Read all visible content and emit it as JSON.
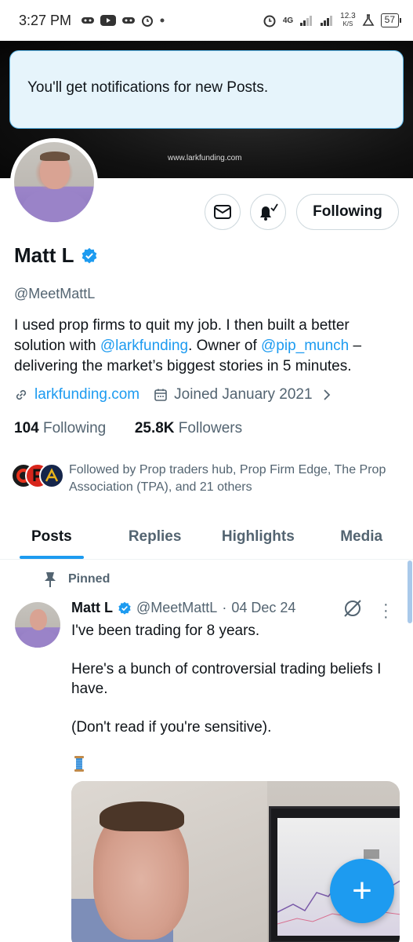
{
  "status_bar": {
    "time": "3:27 PM",
    "network": "4G",
    "speed": "12.3",
    "speed_unit": "K/S",
    "battery": "57"
  },
  "banner": {
    "url_text": "www.larkfunding.com"
  },
  "toast": {
    "message": "You'll get notifications for new Posts."
  },
  "actions": {
    "message_icon": "envelope-icon",
    "notify_icon": "bell-check-icon",
    "following_label": "Following"
  },
  "profile": {
    "name": "Matt L",
    "handle": "@MeetMattL",
    "bio_part1": "I used prop firms to quit my job. I then built a better solution with ",
    "bio_mention1": "@larkfunding",
    "bio_part2": ". Owner of ",
    "bio_mention2": "@pip_munch",
    "bio_part3": " – delivering the market’s biggest stories in 5 minutes.",
    "website": "larkfunding.com",
    "joined": "Joined January 2021",
    "following_count": "104",
    "following_label": "Following",
    "followers_count": "25.8K",
    "followers_label": "Followers",
    "followed_by": "Followed by Prop traders hub, Prop Firm Edge, The Prop Association (TPA), and 21 others"
  },
  "tabs": [
    {
      "label": "Posts",
      "active": true
    },
    {
      "label": "Replies",
      "active": false
    },
    {
      "label": "Highlights",
      "active": false
    },
    {
      "label": "Media",
      "active": false
    }
  ],
  "post": {
    "pinned_label": "Pinned",
    "author_name": "Matt L",
    "author_handle": "@MeetMattL",
    "separator": "·",
    "date": "04 Dec 24",
    "line1": "I've been trading for 8 years.",
    "line2": "Here's a bunch of controversial trading beliefs I have.",
    "line3": "(Don't read if you're sensitive)."
  },
  "fab": {
    "label": "+"
  },
  "colors": {
    "accent": "#1d9bf0",
    "secondary_text": "#536471",
    "toast_bg": "#e6f4fb"
  }
}
